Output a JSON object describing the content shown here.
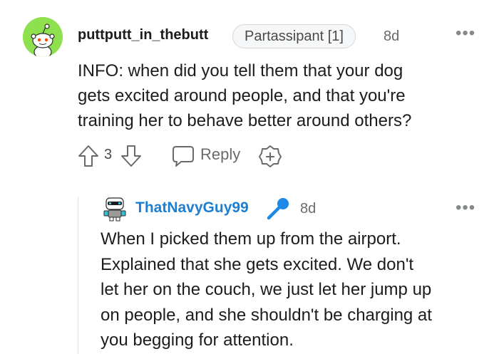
{
  "comment": {
    "avatar_color": "#8ee04e",
    "username": "puttputt_in_thebutt",
    "flair": "Partassipant [1]",
    "time": "8d",
    "more_icon": "more-horizontal-icon",
    "body_lines": [
      "INFO: when did you tell them that your dog",
      "gets excited around people, and that you're",
      "training her to behave better around others?"
    ],
    "vote_count": "3",
    "reply_label": "Reply",
    "icons": [
      "upvote-arrow-icon",
      "downvote-arrow-icon",
      "chat-bubble-icon",
      "award-plus-icon"
    ]
  },
  "reply": {
    "username": "ThatNavyGuy99",
    "username_color": "#1d7fd1",
    "time": "8d",
    "mic_icon": "microphone-icon",
    "more_icon": "more-horizontal-icon",
    "body_lines": [
      "When I picked them up from the airport.",
      "Explained that she gets excited. We don't",
      "let her on the couch, we just let her jump up",
      "on people, and she shouldn't be charging at",
      "you begging for attention."
    ]
  }
}
